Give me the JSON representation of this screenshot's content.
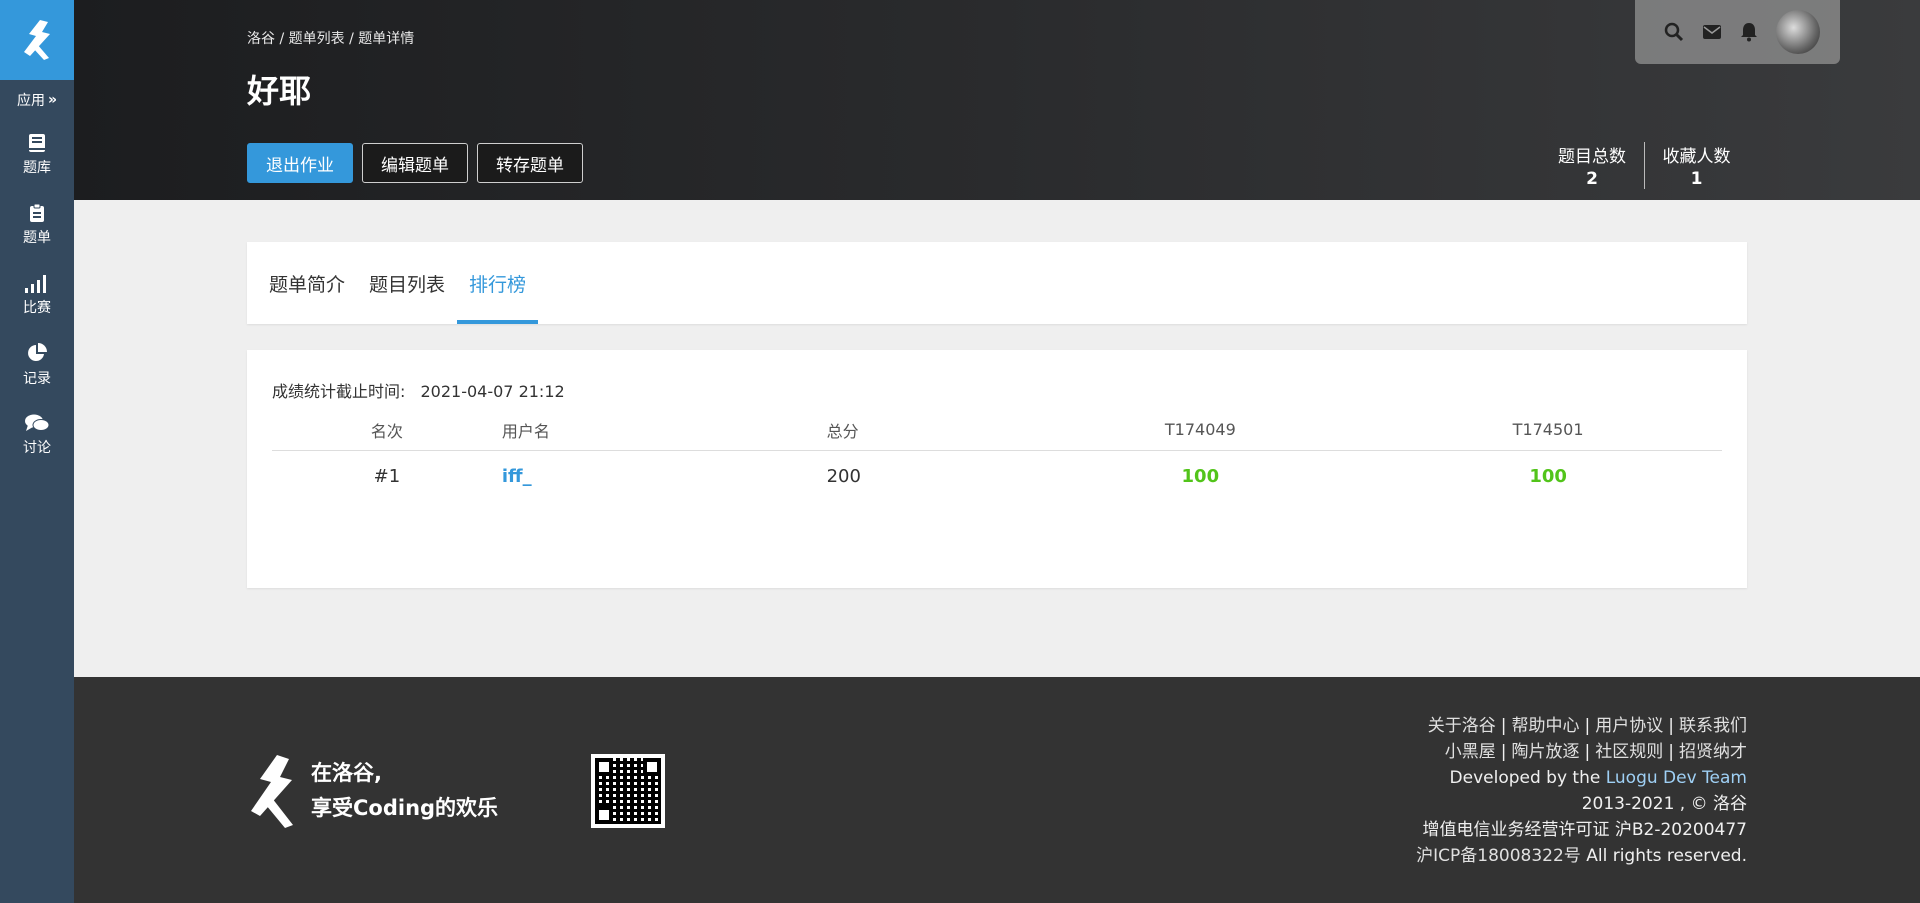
{
  "sidebar": {
    "apps_label": "应用",
    "items": [
      {
        "label": "题库",
        "icon": "book-icon"
      },
      {
        "label": "题单",
        "icon": "clipboard-icon"
      },
      {
        "label": "比赛",
        "icon": "bar-chart-icon"
      },
      {
        "label": "记录",
        "icon": "pie-chart-icon"
      },
      {
        "label": "讨论",
        "icon": "chat-icon"
      }
    ]
  },
  "header": {
    "breadcrumb": "洛谷 / 题单列表 / 题单详情",
    "title": "好耶",
    "buttons": {
      "exit": "退出作业",
      "edit": "编辑题单",
      "transfer": "转存题单"
    },
    "stats": [
      {
        "label": "题目总数",
        "value": "2"
      },
      {
        "label": "收藏人数",
        "value": "1"
      }
    ]
  },
  "tabs": [
    {
      "label": "题单简介"
    },
    {
      "label": "题目列表"
    },
    {
      "label": "排行榜"
    }
  ],
  "ranking": {
    "deadline_label": "成绩统计截止时间:",
    "deadline_value": "2021-04-07 21:12",
    "columns": [
      "名次",
      "用户名",
      "总分",
      "T174049",
      "T174501"
    ],
    "rows": [
      {
        "rank": "#1",
        "user": "iff_",
        "total": "200",
        "scores": [
          "100",
          "100"
        ]
      }
    ]
  },
  "footer": {
    "slogan_line1": "在洛谷,",
    "slogan_line2": "享受Coding的欢乐",
    "links_row1": [
      "关于洛谷",
      "帮助中心",
      "用户协议",
      "联系我们"
    ],
    "links_row2": [
      "小黑屋",
      "陶片放逐",
      "社区规则",
      "招贤纳才"
    ],
    "developed_prefix": "Developed by the",
    "team": "Luogu Dev Team",
    "copyright": "2013-2021 , © 洛谷",
    "license": "增值电信业务经营许可证 沪B2-20200477",
    "icp": "沪ICP备18008322号",
    "rights": "All rights reserved."
  },
  "colors": {
    "accent": "#3498db",
    "sidebar": "#34495e",
    "score": "#52c41a"
  }
}
